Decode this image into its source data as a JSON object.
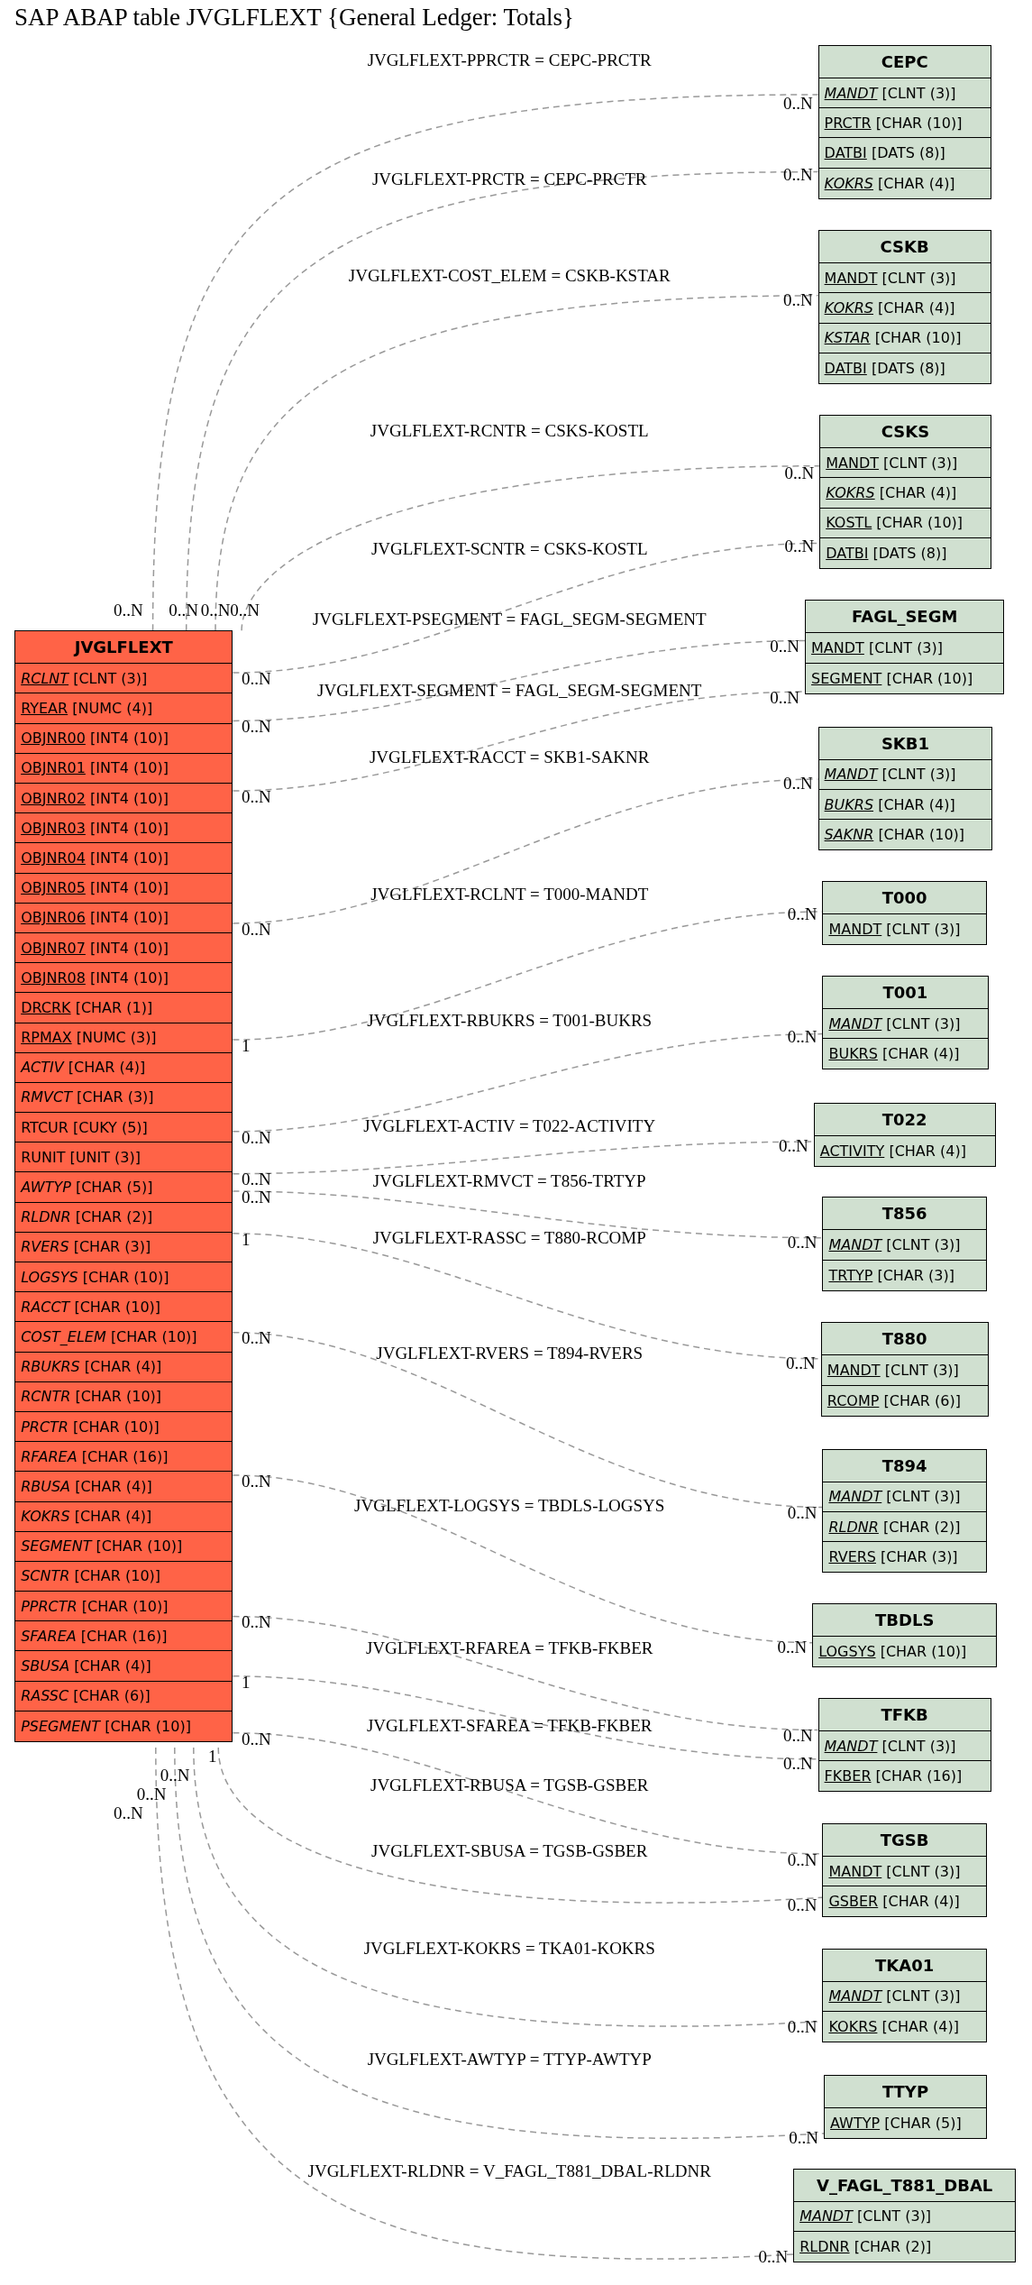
{
  "title": "SAP ABAP table JVGLFLEXT {General Ledger: Totals}",
  "main_table": {
    "name": "JVGLFLEXT",
    "fields": [
      {
        "name": "RCLNT",
        "type": "[CLNT (3)]",
        "key": true,
        "italic": true
      },
      {
        "name": "RYEAR",
        "type": "[NUMC (4)]",
        "key": true,
        "italic": false
      },
      {
        "name": "OBJNR00",
        "type": "[INT4 (10)]",
        "key": true,
        "italic": false
      },
      {
        "name": "OBJNR01",
        "type": "[INT4 (10)]",
        "key": true,
        "italic": false
      },
      {
        "name": "OBJNR02",
        "type": "[INT4 (10)]",
        "key": true,
        "italic": false
      },
      {
        "name": "OBJNR03",
        "type": "[INT4 (10)]",
        "key": true,
        "italic": false
      },
      {
        "name": "OBJNR04",
        "type": "[INT4 (10)]",
        "key": true,
        "italic": false
      },
      {
        "name": "OBJNR05",
        "type": "[INT4 (10)]",
        "key": true,
        "italic": false
      },
      {
        "name": "OBJNR06",
        "type": "[INT4 (10)]",
        "key": true,
        "italic": false
      },
      {
        "name": "OBJNR07",
        "type": "[INT4 (10)]",
        "key": true,
        "italic": false
      },
      {
        "name": "OBJNR08",
        "type": "[INT4 (10)]",
        "key": true,
        "italic": false
      },
      {
        "name": "DRCRK",
        "type": "[CHAR (1)]",
        "key": true,
        "italic": false
      },
      {
        "name": "RPMAX",
        "type": "[NUMC (3)]",
        "key": true,
        "italic": false
      },
      {
        "name": "ACTIV",
        "type": "[CHAR (4)]",
        "key": false,
        "italic": true
      },
      {
        "name": "RMVCT",
        "type": "[CHAR (3)]",
        "key": false,
        "italic": true
      },
      {
        "name": "RTCUR",
        "type": "[CUKY (5)]",
        "key": false,
        "italic": false
      },
      {
        "name": "RUNIT",
        "type": "[UNIT (3)]",
        "key": false,
        "italic": false
      },
      {
        "name": "AWTYP",
        "type": "[CHAR (5)]",
        "key": false,
        "italic": true
      },
      {
        "name": "RLDNR",
        "type": "[CHAR (2)]",
        "key": false,
        "italic": true
      },
      {
        "name": "RVERS",
        "type": "[CHAR (3)]",
        "key": false,
        "italic": true
      },
      {
        "name": "LOGSYS",
        "type": "[CHAR (10)]",
        "key": false,
        "italic": true
      },
      {
        "name": "RACCT",
        "type": "[CHAR (10)]",
        "key": false,
        "italic": true
      },
      {
        "name": "COST_ELEM",
        "type": "[CHAR (10)]",
        "key": false,
        "italic": true
      },
      {
        "name": "RBUKRS",
        "type": "[CHAR (4)]",
        "key": false,
        "italic": true
      },
      {
        "name": "RCNTR",
        "type": "[CHAR (10)]",
        "key": false,
        "italic": true
      },
      {
        "name": "PRCTR",
        "type": "[CHAR (10)]",
        "key": false,
        "italic": true
      },
      {
        "name": "RFAREA",
        "type": "[CHAR (16)]",
        "key": false,
        "italic": true
      },
      {
        "name": "RBUSA",
        "type": "[CHAR (4)]",
        "key": false,
        "italic": true
      },
      {
        "name": "KOKRS",
        "type": "[CHAR (4)]",
        "key": false,
        "italic": true
      },
      {
        "name": "SEGMENT",
        "type": "[CHAR (10)]",
        "key": false,
        "italic": true
      },
      {
        "name": "SCNTR",
        "type": "[CHAR (10)]",
        "key": false,
        "italic": true
      },
      {
        "name": "PPRCTR",
        "type": "[CHAR (10)]",
        "key": false,
        "italic": true
      },
      {
        "name": "SFAREA",
        "type": "[CHAR (16)]",
        "key": false,
        "italic": true
      },
      {
        "name": "SBUSA",
        "type": "[CHAR (4)]",
        "key": false,
        "italic": true
      },
      {
        "name": "RASSC",
        "type": "[CHAR (6)]",
        "key": false,
        "italic": true
      },
      {
        "name": "PSEGMENT",
        "type": "[CHAR (10)]",
        "key": false,
        "italic": true
      }
    ]
  },
  "tables": [
    {
      "name": "CEPC",
      "fields": [
        {
          "name": "MANDT",
          "type": "[CLNT (3)]",
          "key": true,
          "italic": true
        },
        {
          "name": "PRCTR",
          "type": "[CHAR (10)]",
          "key": true,
          "italic": false
        },
        {
          "name": "DATBI",
          "type": "[DATS (8)]",
          "key": true,
          "italic": false
        },
        {
          "name": "KOKRS",
          "type": "[CHAR (4)]",
          "key": true,
          "italic": true
        }
      ]
    },
    {
      "name": "CSKB",
      "fields": [
        {
          "name": "MANDT",
          "type": "[CLNT (3)]",
          "key": true,
          "italic": false
        },
        {
          "name": "KOKRS",
          "type": "[CHAR (4)]",
          "key": true,
          "italic": true
        },
        {
          "name": "KSTAR",
          "type": "[CHAR (10)]",
          "key": true,
          "italic": true
        },
        {
          "name": "DATBI",
          "type": "[DATS (8)]",
          "key": true,
          "italic": false
        }
      ]
    },
    {
      "name": "CSKS",
      "fields": [
        {
          "name": "MANDT",
          "type": "[CLNT (3)]",
          "key": true,
          "italic": false
        },
        {
          "name": "KOKRS",
          "type": "[CHAR (4)]",
          "key": true,
          "italic": true
        },
        {
          "name": "KOSTL",
          "type": "[CHAR (10)]",
          "key": true,
          "italic": false
        },
        {
          "name": "DATBI",
          "type": "[DATS (8)]",
          "key": true,
          "italic": false
        }
      ]
    },
    {
      "name": "FAGL_SEGM",
      "fields": [
        {
          "name": "MANDT",
          "type": "[CLNT (3)]",
          "key": true,
          "italic": false
        },
        {
          "name": "SEGMENT",
          "type": "[CHAR (10)]",
          "key": true,
          "italic": false
        }
      ]
    },
    {
      "name": "SKB1",
      "fields": [
        {
          "name": "MANDT",
          "type": "[CLNT (3)]",
          "key": true,
          "italic": true
        },
        {
          "name": "BUKRS",
          "type": "[CHAR (4)]",
          "key": true,
          "italic": true
        },
        {
          "name": "SAKNR",
          "type": "[CHAR (10)]",
          "key": true,
          "italic": true
        }
      ]
    },
    {
      "name": "T000",
      "fields": [
        {
          "name": "MANDT",
          "type": "[CLNT (3)]",
          "key": true,
          "italic": false
        }
      ]
    },
    {
      "name": "T001",
      "fields": [
        {
          "name": "MANDT",
          "type": "[CLNT (3)]",
          "key": true,
          "italic": true
        },
        {
          "name": "BUKRS",
          "type": "[CHAR (4)]",
          "key": true,
          "italic": false
        }
      ]
    },
    {
      "name": "T022",
      "fields": [
        {
          "name": "ACTIVITY",
          "type": "[CHAR (4)]",
          "key": true,
          "italic": false
        }
      ]
    },
    {
      "name": "T856",
      "fields": [
        {
          "name": "MANDT",
          "type": "[CLNT (3)]",
          "key": true,
          "italic": true
        },
        {
          "name": "TRTYP",
          "type": "[CHAR (3)]",
          "key": true,
          "italic": false
        }
      ]
    },
    {
      "name": "T880",
      "fields": [
        {
          "name": "MANDT",
          "type": "[CLNT (3)]",
          "key": true,
          "italic": false
        },
        {
          "name": "RCOMP",
          "type": "[CHAR (6)]",
          "key": true,
          "italic": false
        }
      ]
    },
    {
      "name": "T894",
      "fields": [
        {
          "name": "MANDT",
          "type": "[CLNT (3)]",
          "key": true,
          "italic": true
        },
        {
          "name": "RLDNR",
          "type": "[CHAR (2)]",
          "key": true,
          "italic": true
        },
        {
          "name": "RVERS",
          "type": "[CHAR (3)]",
          "key": true,
          "italic": false
        }
      ]
    },
    {
      "name": "TBDLS",
      "fields": [
        {
          "name": "LOGSYS",
          "type": "[CHAR (10)]",
          "key": true,
          "italic": false
        }
      ]
    },
    {
      "name": "TFKB",
      "fields": [
        {
          "name": "MANDT",
          "type": "[CLNT (3)]",
          "key": true,
          "italic": true
        },
        {
          "name": "FKBER",
          "type": "[CHAR (16)]",
          "key": true,
          "italic": false
        }
      ]
    },
    {
      "name": "TGSB",
      "fields": [
        {
          "name": "MANDT",
          "type": "[CLNT (3)]",
          "key": true,
          "italic": false
        },
        {
          "name": "GSBER",
          "type": "[CHAR (4)]",
          "key": true,
          "italic": false
        }
      ]
    },
    {
      "name": "TKA01",
      "fields": [
        {
          "name": "MANDT",
          "type": "[CLNT (3)]",
          "key": true,
          "italic": true
        },
        {
          "name": "KOKRS",
          "type": "[CHAR (4)]",
          "key": true,
          "italic": false
        }
      ]
    },
    {
      "name": "TTYP",
      "fields": [
        {
          "name": "AWTYP",
          "type": "[CHAR (5)]",
          "key": true,
          "italic": false
        }
      ]
    },
    {
      "name": "V_FAGL_T881_DBAL",
      "fields": [
        {
          "name": "MANDT",
          "type": "[CLNT (3)]",
          "key": true,
          "italic": true
        },
        {
          "name": "RLDNR",
          "type": "[CHAR (2)]",
          "key": true,
          "italic": false
        }
      ]
    }
  ],
  "relationships": [
    {
      "label": "JVGLFLEXT-PPRCTR = CEPC-PRCTR",
      "source_cardinality": "0..N",
      "target_cardinality": "0..N"
    },
    {
      "label": "JVGLFLEXT-PRCTR = CEPC-PRCTR",
      "source_cardinality": "0..N",
      "target_cardinality": "0..N"
    },
    {
      "label": "JVGLFLEXT-COST_ELEM = CSKB-KSTAR",
      "source_cardinality": "0..N",
      "target_cardinality": "0..N"
    },
    {
      "label": "JVGLFLEXT-RCNTR = CSKS-KOSTL",
      "source_cardinality": "0..N",
      "target_cardinality": "0..N"
    },
    {
      "label": "JVGLFLEXT-SCNTR = CSKS-KOSTL",
      "source_cardinality": "0..N",
      "target_cardinality": "0..N"
    },
    {
      "label": "JVGLFLEXT-PSEGMENT = FAGL_SEGM-SEGMENT",
      "source_cardinality": "0..N",
      "target_cardinality": "0..N"
    },
    {
      "label": "JVGLFLEXT-SEGMENT = FAGL_SEGM-SEGMENT",
      "source_cardinality": "0..N",
      "target_cardinality": "0..N"
    },
    {
      "label": "JVGLFLEXT-RACCT = SKB1-SAKNR",
      "source_cardinality": "0..N",
      "target_cardinality": "0..N"
    },
    {
      "label": "JVGLFLEXT-RCLNT = T000-MANDT",
      "source_cardinality": "1",
      "target_cardinality": "0..N"
    },
    {
      "label": "JVGLFLEXT-RBUKRS = T001-BUKRS",
      "source_cardinality": "0..N",
      "target_cardinality": "0..N"
    },
    {
      "label": "JVGLFLEXT-ACTIV = T022-ACTIVITY",
      "source_cardinality": "0..N",
      "target_cardinality": "0..N"
    },
    {
      "label": "JVGLFLEXT-RMVCT = T856-TRTYP",
      "source_cardinality": "0..N",
      "target_cardinality": "0..N"
    },
    {
      "label": "JVGLFLEXT-RASSC = T880-RCOMP",
      "source_cardinality": "1",
      "target_cardinality": "0..N"
    },
    {
      "label": "JVGLFLEXT-RVERS = T894-RVERS",
      "source_cardinality": "0..N",
      "target_cardinality": "0..N"
    },
    {
      "label": "JVGLFLEXT-LOGSYS = TBDLS-LOGSYS",
      "source_cardinality": "0..N",
      "target_cardinality": "0..N"
    },
    {
      "label": "JVGLFLEXT-RFAREA = TFKB-FKBER",
      "source_cardinality": "0..N",
      "target_cardinality": "0..N"
    },
    {
      "label": "JVGLFLEXT-SFAREA = TFKB-FKBER",
      "source_cardinality": "1",
      "target_cardinality": "0..N"
    },
    {
      "label": "JVGLFLEXT-RBUSA = TGSB-GSBER",
      "source_cardinality": "0..N",
      "target_cardinality": "0..N"
    },
    {
      "label": "JVGLFLEXT-SBUSA = TGSB-GSBER",
      "source_cardinality": "1",
      "target_cardinality": "0..N"
    },
    {
      "label": "JVGLFLEXT-KOKRS = TKA01-KOKRS",
      "source_cardinality": "0..N",
      "target_cardinality": "0..N"
    },
    {
      "label": "JVGLFLEXT-AWTYP = TTYP-AWTYP",
      "source_cardinality": "0..N",
      "target_cardinality": "0..N"
    },
    {
      "label": "JVGLFLEXT-RLDNR = V_FAGL_T881_DBAL-RLDNR",
      "source_cardinality": "0..N",
      "target_cardinality": "0..N"
    }
  ]
}
